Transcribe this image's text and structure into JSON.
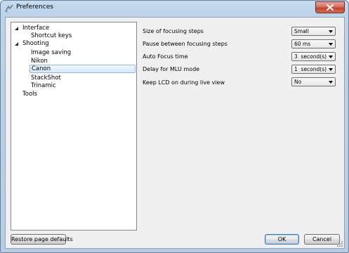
{
  "window": {
    "title": "Preferences"
  },
  "tree": {
    "items": [
      {
        "label": "Interface",
        "expanded": true
      },
      {
        "label": "Shortcut keys"
      },
      {
        "label": "Shooting",
        "expanded": true
      },
      {
        "label": "Image saving"
      },
      {
        "label": "Nikon"
      },
      {
        "label": "Canon",
        "selected": true
      },
      {
        "label": "StackShot"
      },
      {
        "label": "Trinamic"
      },
      {
        "label": "Tools"
      }
    ]
  },
  "settings": [
    {
      "label": "Size of focusing steps",
      "value": "Small"
    },
    {
      "label": "Pause between focusing steps",
      "value": "60 ms"
    },
    {
      "label": "Auto Focus time",
      "value": "3  second(s)"
    },
    {
      "label": "Delay for MLU mode",
      "value": "1  second(s)"
    },
    {
      "label": "Keep LCD on during live view",
      "value": "No"
    }
  ],
  "buttons": {
    "restore_defaults": "Restore page defaults",
    "ok": "OK",
    "cancel": "Cancel"
  }
}
